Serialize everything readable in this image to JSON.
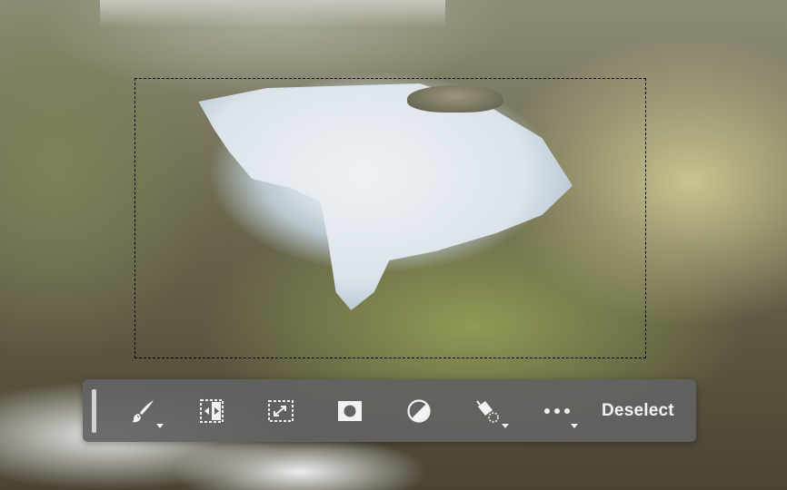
{
  "canvas": {
    "description_free": true
  },
  "contextual_taskbar": {
    "tools": [
      {
        "name": "select-and-mask-brush",
        "icon": "brush-icon",
        "has_dropdown": true
      },
      {
        "name": "select-subject-invert",
        "icon": "invert-selection-icon",
        "has_dropdown": false
      },
      {
        "name": "transform-selection",
        "icon": "transform-selection-icon",
        "has_dropdown": false
      },
      {
        "name": "create-mask",
        "icon": "mask-icon",
        "has_dropdown": false
      },
      {
        "name": "adjustment-layer",
        "icon": "adjustment-circle-icon",
        "has_dropdown": false
      },
      {
        "name": "fill-selection",
        "icon": "paint-bucket-icon",
        "has_dropdown": true
      },
      {
        "name": "more-options",
        "icon": "more-dots-icon",
        "has_dropdown": true
      }
    ],
    "deselect_label": "Deselect"
  },
  "colors": {
    "toolbar_bg": "#626262",
    "icon_color": "#f2f2f2",
    "marquee_light": "#ffffff",
    "marquee_dark": "#000000"
  }
}
